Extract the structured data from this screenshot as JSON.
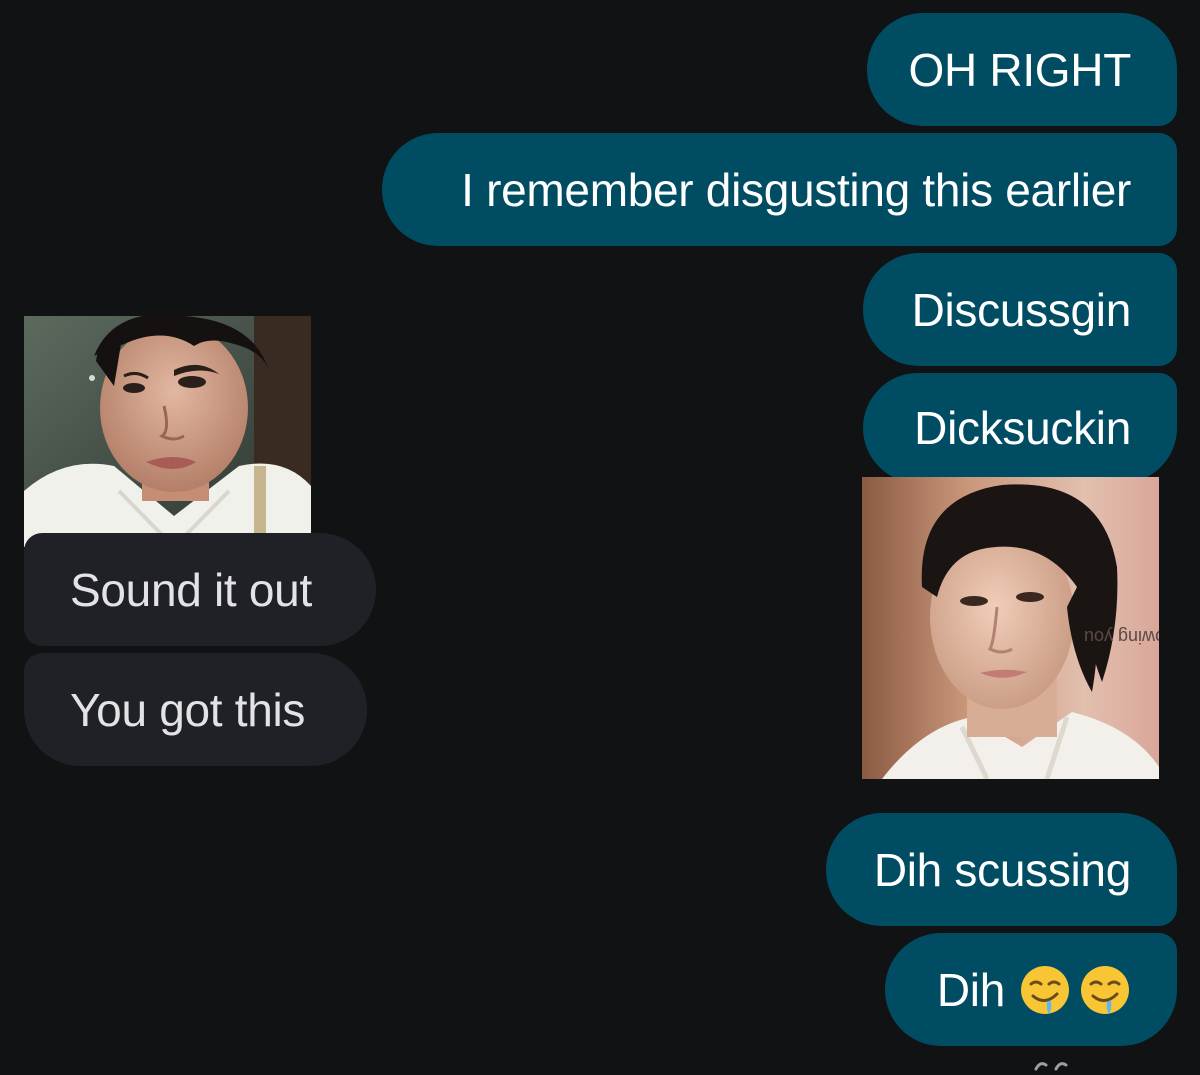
{
  "conversation": {
    "outgoing_group_1": [
      {
        "text": "OH RIGHT"
      },
      {
        "text": "I remember disgusting this earlier"
      },
      {
        "text": "Discussgin"
      },
      {
        "text": "Dicksuckin"
      }
    ],
    "incoming_group": [
      {
        "text": "Sound it out"
      },
      {
        "text": "You got this"
      }
    ],
    "outgoing_group_2": [
      {
        "text": "Dih scussing"
      },
      {
        "text": "Dih",
        "emoji": [
          "drooling-face",
          "drooling-face"
        ]
      }
    ]
  },
  "images": {
    "incoming_photo": {
      "alt": "photo of a young man with dark hair in a white shirt"
    },
    "outgoing_photo": {
      "alt": "photo of a young man with dark hair in a white shirt",
      "caption": "owing you"
    }
  },
  "colors": {
    "background": "#111214",
    "outgoing_bubble": "#004d63",
    "incoming_bubble": "#1f2126",
    "text": "#ffffff"
  }
}
